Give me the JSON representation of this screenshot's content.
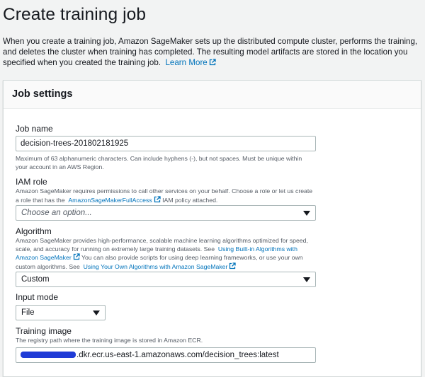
{
  "header": {
    "title": "Create training job",
    "description": "When you create a training job, Amazon SageMaker sets up the distributed compute cluster, performs the training, and deletes the cluster when training has completed. The resulting model artifacts are stored in the location you specified when you created the training job.",
    "learn_more": "Learn More"
  },
  "panel": {
    "title": "Job settings"
  },
  "job_name": {
    "label": "Job name",
    "value": "decision-trees-201802181925",
    "hint": "Maximum of 63 alphanumeric characters. Can include hyphens (-), but not spaces. Must be unique within your account in an AWS Region."
  },
  "iam_role": {
    "label": "IAM role",
    "desc_before": "Amazon SageMaker requires permissions to call other services on your behalf. Choose a role or let us create a role that has the",
    "policy_link": "AmazonSageMakerFullAccess",
    "desc_after": "IAM policy attached.",
    "placeholder": "Choose an option..."
  },
  "algorithm": {
    "label": "Algorithm",
    "desc_1": "Amazon SageMaker provides high-performance, scalable machine learning algorithms optimized for speed, scale, and accuracy for running on extremely large training datasets. See",
    "link_1": "Using Built-in Algorithms with Amazon SageMaker",
    "desc_2": "You can also provide scripts for using deep learning frameworks, or use your own custom algorithms. See",
    "link_2": "Using Your Own Algorithms with Amazon SageMaker",
    "selected": "Custom"
  },
  "input_mode": {
    "label": "Input mode",
    "selected": "File"
  },
  "training_image": {
    "label": "Training image",
    "desc": "The registry path where the training image is stored in Amazon ECR.",
    "value_visible": ".dkr.ecr.us-east-1.amazonaws.com/decision_trees:latest"
  },
  "colors": {
    "link": "#0073bb",
    "background": "#f2f3f3",
    "redaction": "#1f3bd6"
  }
}
